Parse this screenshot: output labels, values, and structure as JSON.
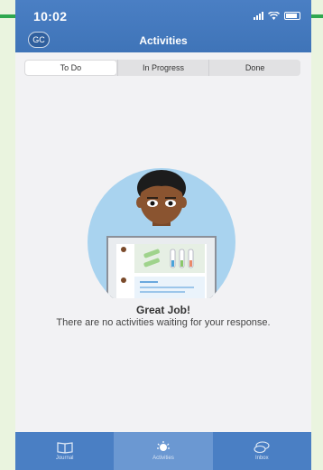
{
  "status_bar": {
    "time": "10:02"
  },
  "header": {
    "avatar_initials": "GC",
    "title": "Activities"
  },
  "tabs": [
    {
      "label": "To Do",
      "active": true
    },
    {
      "label": "In Progress",
      "active": false
    },
    {
      "label": "Done",
      "active": false
    }
  ],
  "empty_state": {
    "title": "Great Job!",
    "message": "There are no activities waiting for your response."
  },
  "tabbar": [
    {
      "label": "Journal",
      "icon": "book-icon",
      "active": false
    },
    {
      "label": "Activities",
      "icon": "activities-icon",
      "active": true
    },
    {
      "label": "Inbox",
      "icon": "chat-bubbles-icon",
      "active": false
    }
  ],
  "colors": {
    "header": "#4a7fc4",
    "tabbar_active": "#6b98d2",
    "background": "#f2f2f4",
    "border_green": "#2fa84f"
  }
}
